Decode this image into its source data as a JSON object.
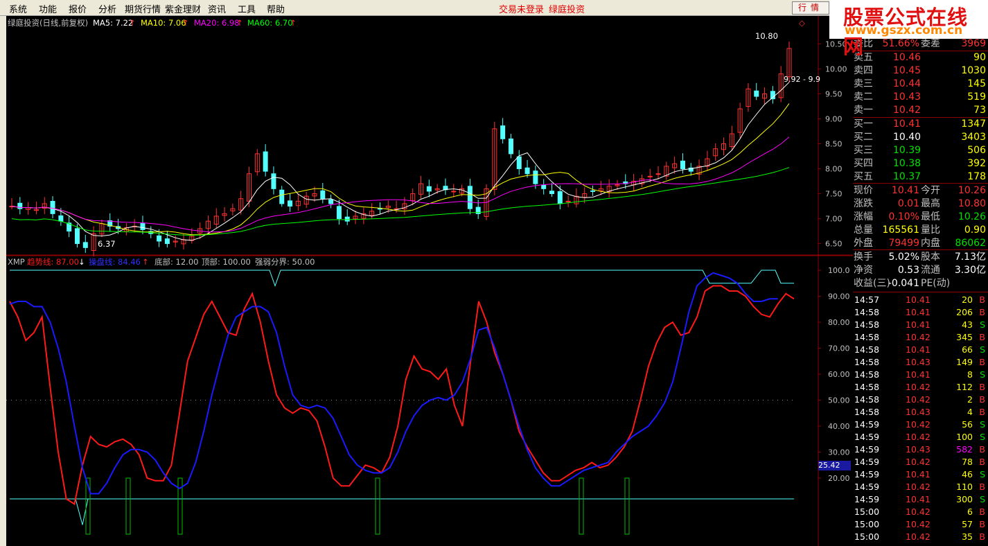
{
  "menu": {
    "items": [
      "系统",
      "功能",
      "报价",
      "分析",
      "期货行情",
      "紫金理财",
      "资讯",
      "工具",
      "帮助"
    ],
    "center": [
      "交易未登录",
      "绿庭投资"
    ],
    "hq_button": "行情"
  },
  "watermark": {
    "title": "股票公式在线网",
    "url": "www.gszx.com.cn"
  },
  "main_chart": {
    "name": "绿庭投资(日线,前复权)",
    "ma": [
      {
        "label": "MA5: 7.22",
        "color": "#ffffff"
      },
      {
        "label": "MA10: 7.06",
        "color": "#ffff00"
      },
      {
        "label": "MA20: 6.98",
        "color": "#ff00ff"
      },
      {
        "label": "MA60: 6.70",
        "color": "#00ff00"
      }
    ],
    "y_ticks": [
      "10.50",
      "10.00",
      "9.50",
      "9.00",
      "8.50",
      "8.00",
      "7.50",
      "7.00",
      "6.50"
    ],
    "high_label": "10.80",
    "low_label": "6.37",
    "range_label": "9.92 - 9.9"
  },
  "indicator": {
    "name": "XMP",
    "trend_label": "趋势线: 87.00",
    "control_label": "操盘线: 84.46",
    "bottom_label": "底部: 12.00",
    "top_label": "顶部: 100.00",
    "split_label": "强弱分界: 50.00",
    "y_ticks": [
      "100.0",
      "90.00",
      "80.00",
      "70.00",
      "60.00",
      "50.00",
      "40.00",
      "30.00",
      "20.00"
    ],
    "cursor_value": "25.42"
  },
  "quote": {
    "ratio": {
      "l1": "委比",
      "v1": "51.66%",
      "l2": "委差",
      "v2": "3969"
    },
    "asks": [
      {
        "label": "卖五",
        "price": "10.46",
        "vol": "90"
      },
      {
        "label": "卖四",
        "price": "10.45",
        "vol": "1030"
      },
      {
        "label": "卖三",
        "price": "10.44",
        "vol": "145"
      },
      {
        "label": "卖二",
        "price": "10.43",
        "vol": "519"
      },
      {
        "label": "卖一",
        "price": "10.42",
        "vol": "73"
      }
    ],
    "bids": [
      {
        "label": "买一",
        "price": "10.41",
        "vol": "1347"
      },
      {
        "label": "买二",
        "price": "10.40",
        "vol": "3403"
      },
      {
        "label": "买三",
        "price": "10.39",
        "vol": "506"
      },
      {
        "label": "买四",
        "price": "10.38",
        "vol": "392"
      },
      {
        "label": "买五",
        "price": "10.37",
        "vol": "178"
      }
    ],
    "stats": [
      {
        "l1": "现价",
        "v1": "10.41",
        "l2": "今开",
        "v2": "10.26"
      },
      {
        "l1": "涨跌",
        "v1": "0.01",
        "l2": "最高",
        "v2": "10.80"
      },
      {
        "l1": "涨幅",
        "v1": "0.10%",
        "l2": "最低",
        "v2": "10.26"
      },
      {
        "l1": "总量",
        "v1": "165561",
        "l2": "量比",
        "v2": "0.90"
      },
      {
        "l1": "外盘",
        "v1": "79499",
        "l2": "内盘",
        "v2": "86062"
      }
    ],
    "extra": [
      {
        "l1": "换手",
        "v1": "5.02%",
        "l2": "股本",
        "v2": "7.13亿"
      },
      {
        "l1": "净资",
        "v1": "0.53",
        "l2": "流通",
        "v2": "3.30亿"
      },
      {
        "l1": "收益(三)",
        "v1": "-0.041",
        "l2": "PE(动)",
        "v2": ""
      }
    ],
    "ticks": [
      {
        "time": "14:57",
        "price": "10.41",
        "vol": "20",
        "bs": "B"
      },
      {
        "time": "14:58",
        "price": "10.41",
        "vol": "206",
        "bs": "B"
      },
      {
        "time": "14:58",
        "price": "10.41",
        "vol": "43",
        "bs": "S"
      },
      {
        "time": "14:58",
        "price": "10.42",
        "vol": "345",
        "bs": "B"
      },
      {
        "time": "14:58",
        "price": "10.41",
        "vol": "66",
        "bs": "S"
      },
      {
        "time": "14:58",
        "price": "10.43",
        "vol": "149",
        "bs": "B"
      },
      {
        "time": "14:58",
        "price": "10.41",
        "vol": "8",
        "bs": "S"
      },
      {
        "time": "14:58",
        "price": "10.42",
        "vol": "112",
        "bs": "B"
      },
      {
        "time": "14:58",
        "price": "10.42",
        "vol": "2",
        "bs": "B"
      },
      {
        "time": "14:58",
        "price": "10.43",
        "vol": "4",
        "bs": "B"
      },
      {
        "time": "14:59",
        "price": "10.42",
        "vol": "56",
        "bs": "S"
      },
      {
        "time": "14:59",
        "price": "10.42",
        "vol": "100",
        "bs": "S"
      },
      {
        "time": "14:59",
        "price": "10.43",
        "vol": "582",
        "bs": "B"
      },
      {
        "time": "14:59",
        "price": "10.42",
        "vol": "78",
        "bs": "B"
      },
      {
        "time": "14:59",
        "price": "10.41",
        "vol": "46",
        "bs": "S"
      },
      {
        "time": "14:59",
        "price": "10.42",
        "vol": "110",
        "bs": "B"
      },
      {
        "time": "14:59",
        "price": "10.41",
        "vol": "300",
        "bs": "S"
      },
      {
        "time": "15:00",
        "price": "10.42",
        "vol": "6",
        "bs": "B"
      },
      {
        "time": "15:00",
        "price": "10.42",
        "vol": "57",
        "bs": "B"
      },
      {
        "time": "15:00",
        "price": "10.42",
        "vol": "35",
        "bs": "B"
      }
    ]
  },
  "colors": {
    "up": "#ff3232",
    "down": "#54ffff",
    "trend": "#ff1a1a",
    "control": "#1a1aff",
    "grid": "#8b0000",
    "level": "#54ffff",
    "buy": "#00c000"
  },
  "chart_data": {
    "type": "line",
    "price_range": [
      6.3,
      10.95
    ],
    "indicator_range": [
      0,
      100
    ],
    "trend": [
      88,
      82,
      73,
      76,
      82,
      55,
      30,
      12,
      10,
      25,
      36,
      33,
      32,
      34,
      35,
      33,
      29,
      20,
      19,
      19,
      25,
      45,
      65,
      74,
      83,
      88,
      82,
      76,
      75,
      85,
      91,
      80,
      65,
      52,
      47,
      45,
      47,
      46,
      42,
      32,
      20,
      17,
      17,
      21,
      25,
      24,
      22,
      28,
      40,
      58,
      67,
      62,
      61,
      58,
      62,
      48,
      40,
      65,
      88,
      80,
      68,
      60,
      50,
      38,
      32,
      27,
      22,
      19,
      19,
      21,
      23,
      24,
      26,
      24,
      25,
      28,
      32,
      38,
      50,
      63,
      72,
      78,
      80,
      75,
      76,
      82,
      92,
      94,
      94,
      92,
      92,
      90,
      86,
      83,
      82,
      87,
      91,
      89
    ],
    "control": [
      87,
      88,
      88,
      86,
      86,
      80,
      70,
      57,
      40,
      24,
      14,
      14,
      18,
      24,
      29,
      31,
      31,
      30,
      27,
      22,
      18,
      16,
      18,
      26,
      38,
      52,
      64,
      75,
      82,
      84,
      86,
      86,
      84,
      76,
      63,
      52,
      48,
      47,
      48,
      47,
      43,
      36,
      29,
      25,
      23,
      22,
      22,
      24,
      30,
      38,
      44,
      48,
      50,
      51,
      50,
      52,
      57,
      66,
      77,
      78,
      70,
      60,
      50,
      40,
      31,
      24,
      20,
      17,
      17,
      19,
      21,
      23,
      24,
      25,
      26,
      30,
      33,
      36,
      38,
      40,
      44,
      49,
      57,
      70,
      84,
      94,
      97,
      99,
      98,
      97,
      95,
      91,
      88,
      88,
      89,
      89
    ]
  }
}
